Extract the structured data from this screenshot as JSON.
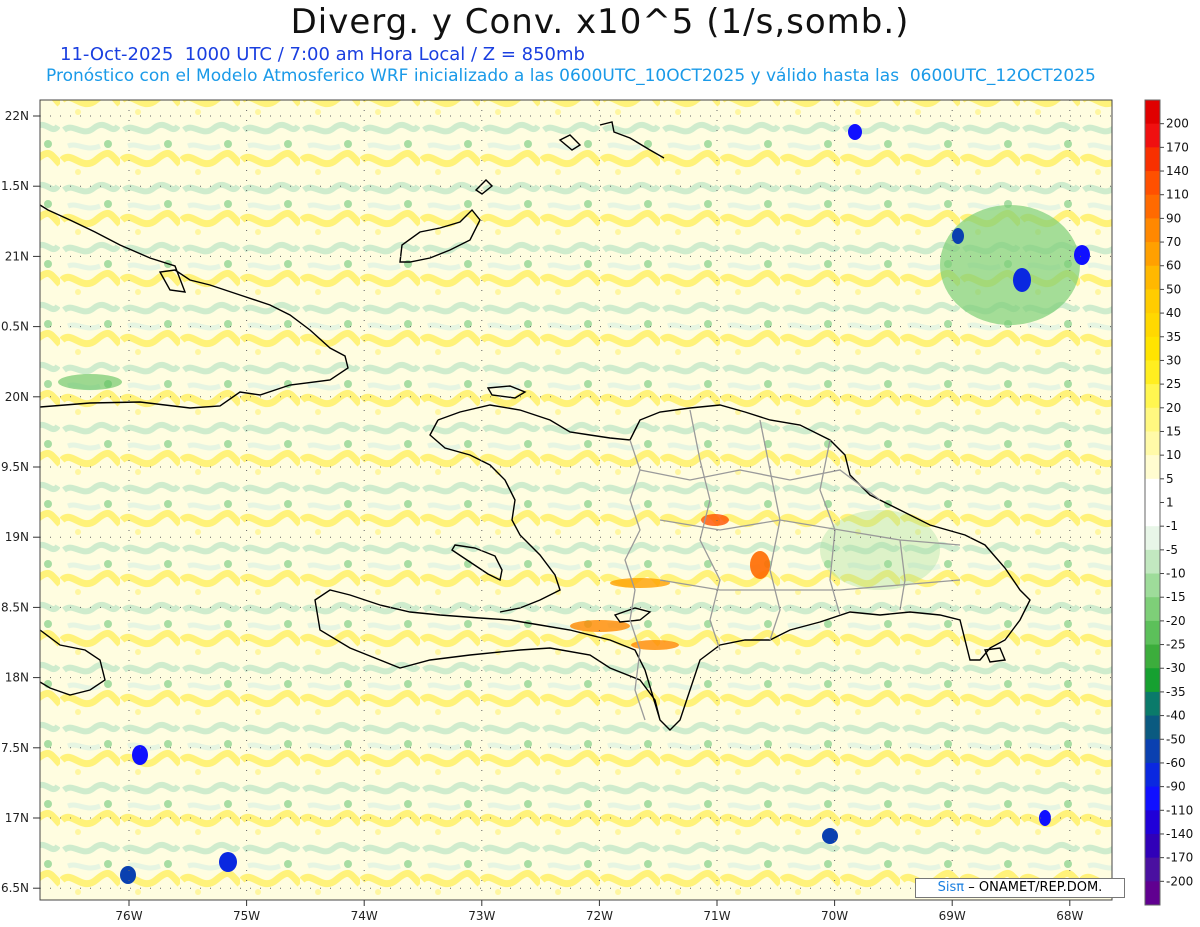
{
  "title": "Diverg. y Conv. x10^5 (1/s,somb.)",
  "subtitle_line1": "11-Oct-2025  1000 UTC / 7:00 am Hora Local / Z = 850mb",
  "subtitle_line2": "Pronóstico con el Modelo Atmosferico WRF inicializado a las 0600UTC_10OCT2025 y válido hasta las  0600UTC_12OCT2025",
  "credit": {
    "logo": "Sisπ",
    "text": "– ONAMET/REP.DOM."
  },
  "map": {
    "lat_range": [
      16.5,
      22.0
    ],
    "lon_range": [
      -76.6,
      -67.6
    ],
    "lat_labels": [
      "22N",
      "1.5N",
      "21N",
      "0.5N",
      "20N",
      "9.5N",
      "19N",
      "8.5N",
      "18N",
      "7.5N",
      "17N",
      "6.5N"
    ],
    "lon_labels": [
      "76W",
      "75W",
      "74W",
      "73W",
      "72W",
      "71W",
      "70W",
      "69W",
      "68W"
    ],
    "gridlines": "dotted"
  },
  "colorbar": {
    "labels": [
      "200",
      "170",
      "140",
      "110",
      "90",
      "70",
      "60",
      "50",
      "40",
      "35",
      "30",
      "25",
      "20",
      "15",
      "10",
      "5",
      "1",
      "-1",
      "-5",
      "-10",
      "-15",
      "-20",
      "-25",
      "-30",
      "-35",
      "-40",
      "-50",
      "-60",
      "-90",
      "-110",
      "-140",
      "-170",
      "-200"
    ],
    "colors": [
      "#e00000",
      "#f01010",
      "#f83000",
      "#ff5000",
      "#ff6a00",
      "#ff8800",
      "#ffa000",
      "#ffb800",
      "#ffcc00",
      "#ffd800",
      "#ffe400",
      "#ffee20",
      "#fff650",
      "#fff880",
      "#fffaa8",
      "#fffcd0",
      "#ffffff",
      "#ffffff",
      "#e8f6e8",
      "#c2e8c0",
      "#9edc9a",
      "#7ecf78",
      "#5cc05a",
      "#3cad3c",
      "#16a030",
      "#0a7a6a",
      "#0a5a80",
      "#0a40b0",
      "#0a28e0",
      "#1010ff",
      "#2000d8",
      "#3000b8",
      "#4a10a0",
      "#600090"
    ]
  }
}
